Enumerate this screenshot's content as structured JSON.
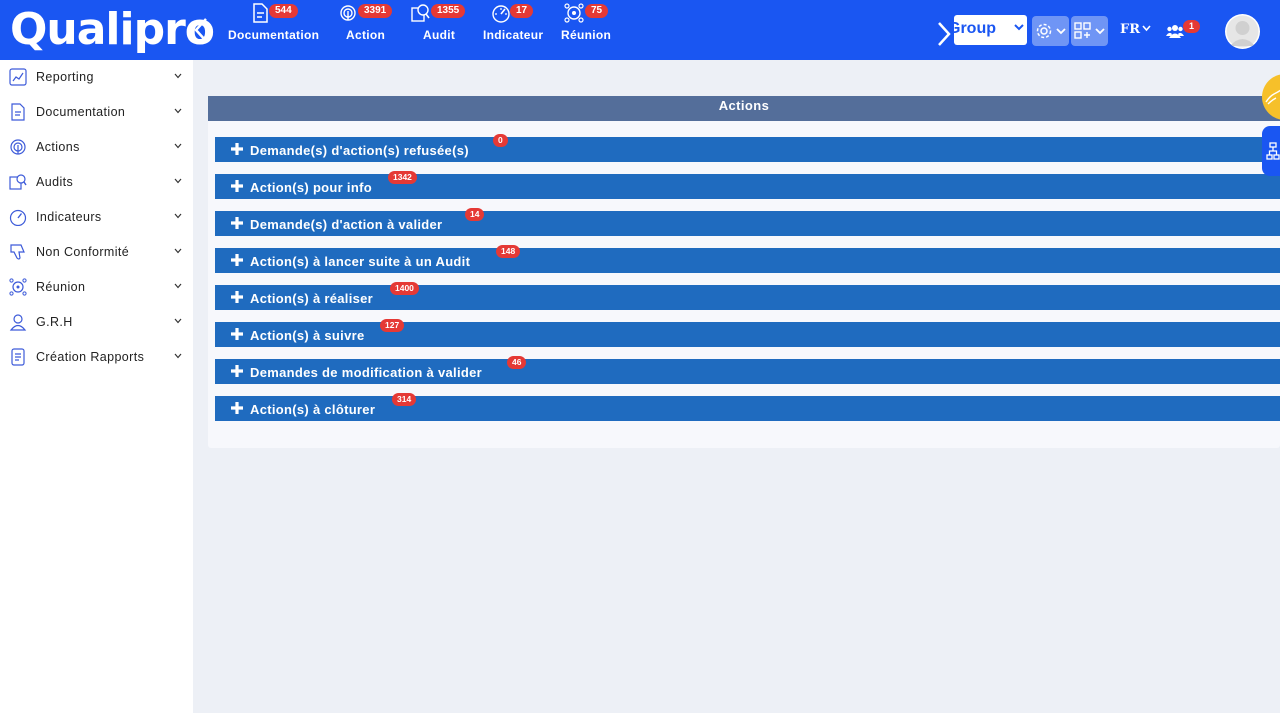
{
  "header": {
    "logo": "Qualipro",
    "modules": [
      {
        "label": "Documentation",
        "badge": "544"
      },
      {
        "label": "Action",
        "badge": "3391"
      },
      {
        "label": "Audit",
        "badge": "1355"
      },
      {
        "label": "Indicateur",
        "badge": "17"
      },
      {
        "label": "Réunion",
        "badge": "75"
      }
    ],
    "group_select": "Group",
    "language": "FR",
    "users_badge": "1"
  },
  "sidebar": {
    "items": [
      {
        "label": "Reporting",
        "icon": "chart-icon"
      },
      {
        "label": "Documentation",
        "icon": "document-icon"
      },
      {
        "label": "Actions",
        "icon": "fingerprint-icon"
      },
      {
        "label": "Audits",
        "icon": "audit-icon"
      },
      {
        "label": "Indicateurs",
        "icon": "gauge-icon"
      },
      {
        "label": "Non Conformité",
        "icon": "thumbs-down-icon"
      },
      {
        "label": "Réunion",
        "icon": "meeting-icon"
      },
      {
        "label": "G.R.H",
        "icon": "user-icon"
      },
      {
        "label": "Création Rapports",
        "icon": "report-icon"
      }
    ]
  },
  "main": {
    "title": "Actions",
    "rows": [
      {
        "label": "Demande(s) d'action(s) refusée(s)",
        "badge": "0"
      },
      {
        "label": "Action(s) pour info",
        "badge": "1342"
      },
      {
        "label": "Demande(s) d'action à valider",
        "badge": "14"
      },
      {
        "label": "Action(s) à lancer suite à un Audit",
        "badge": "148"
      },
      {
        "label": "Action(s) à réaliser",
        "badge": "1400"
      },
      {
        "label": "Action(s) à suivre",
        "badge": "127"
      },
      {
        "label": "Demandes de modification à valider",
        "badge": "46"
      },
      {
        "label": "Action(s) à clôturer",
        "badge": "314"
      }
    ]
  },
  "colors": {
    "topbar": "#1a56f2",
    "row": "#1f6bbf",
    "panel_header": "#546e9a",
    "badge": "#e53935"
  }
}
